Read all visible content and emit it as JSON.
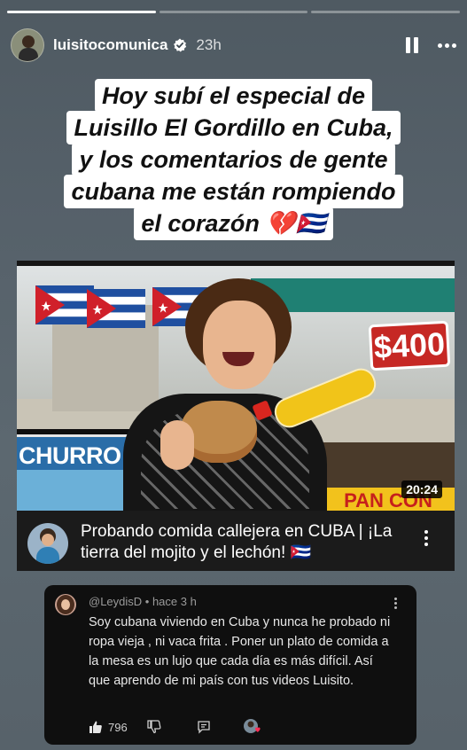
{
  "story": {
    "progress_segments": 3,
    "progress_completed": 1
  },
  "header": {
    "username": "luisitocomunica",
    "time": "23h"
  },
  "caption": {
    "lines": [
      "Hoy subí el especial de",
      "Luisillo El Gordillo en Cuba,",
      "y los comentarios de gente",
      "cubana me están rompiendo",
      "el corazón 💔🇨🇺"
    ]
  },
  "video": {
    "thumbnail_text": {
      "churros": "CHURRO",
      "price": "$400",
      "pan_con": "PAN CON"
    },
    "duration": "20:24",
    "title": "Probando comida callejera en CUBA | ¡La tierra del mojito y el lechón! 🇨🇺"
  },
  "comment": {
    "author": "@LeydisD",
    "when": "hace 3 h",
    "meta": "@LeydisD • hace 3 h",
    "text": "Soy cubana viviendo en Cuba y nunca he probado ni ropa vieja , ni vaca frita . Poner un plato de comida a la mesa es un lujo que cada día es más difícil. Así que aprendo de mi país con tus videos Luisito.",
    "likes": "796"
  },
  "colors": {
    "cuba_blue": "#1f4fa0",
    "cuba_red": "#d0202a",
    "verified_blue": "#3897f0"
  }
}
